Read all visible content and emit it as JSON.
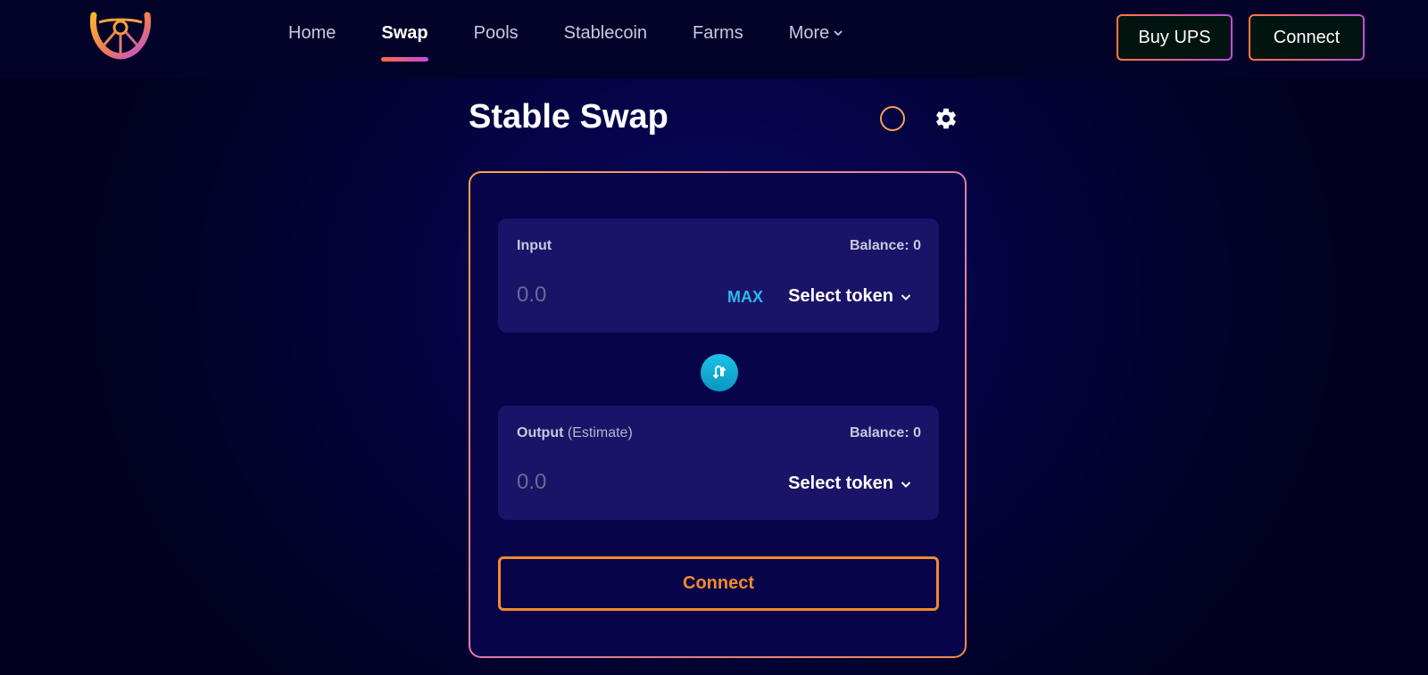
{
  "nav": {
    "items": [
      {
        "label": "Home",
        "active": false
      },
      {
        "label": "Swap",
        "active": true
      },
      {
        "label": "Pools",
        "active": false
      },
      {
        "label": "Stablecoin",
        "active": false
      },
      {
        "label": "Farms",
        "active": false
      },
      {
        "label": "More",
        "active": false
      }
    ]
  },
  "header": {
    "buy_label": "Buy UPS",
    "connect_label": "Connect"
  },
  "page": {
    "title": "Stable Swap"
  },
  "input_panel": {
    "label": "Input",
    "balance": "Balance: 0",
    "amount_placeholder": "0.0",
    "max_label": "MAX",
    "select_token_label": "Select token"
  },
  "output_panel": {
    "label": "Output",
    "label_sub": "(Estimate)",
    "balance": "Balance: 0",
    "amount_placeholder": "0.0",
    "select_token_label": "Select token"
  },
  "card": {
    "connect_label": "Connect"
  },
  "icons": {
    "logo": "steering-wheel-logo",
    "settings": "gear-icon",
    "swap_direction": "swap-arrows-icon",
    "dropdown": "chevron-down-icon",
    "loading": "ring-icon"
  },
  "colors": {
    "background": "#02012e",
    "accent_orange": "#f08a2e",
    "accent_purple": "#c44bde",
    "accent_cyan": "#2cb9ee",
    "panel": "#1a1468"
  }
}
